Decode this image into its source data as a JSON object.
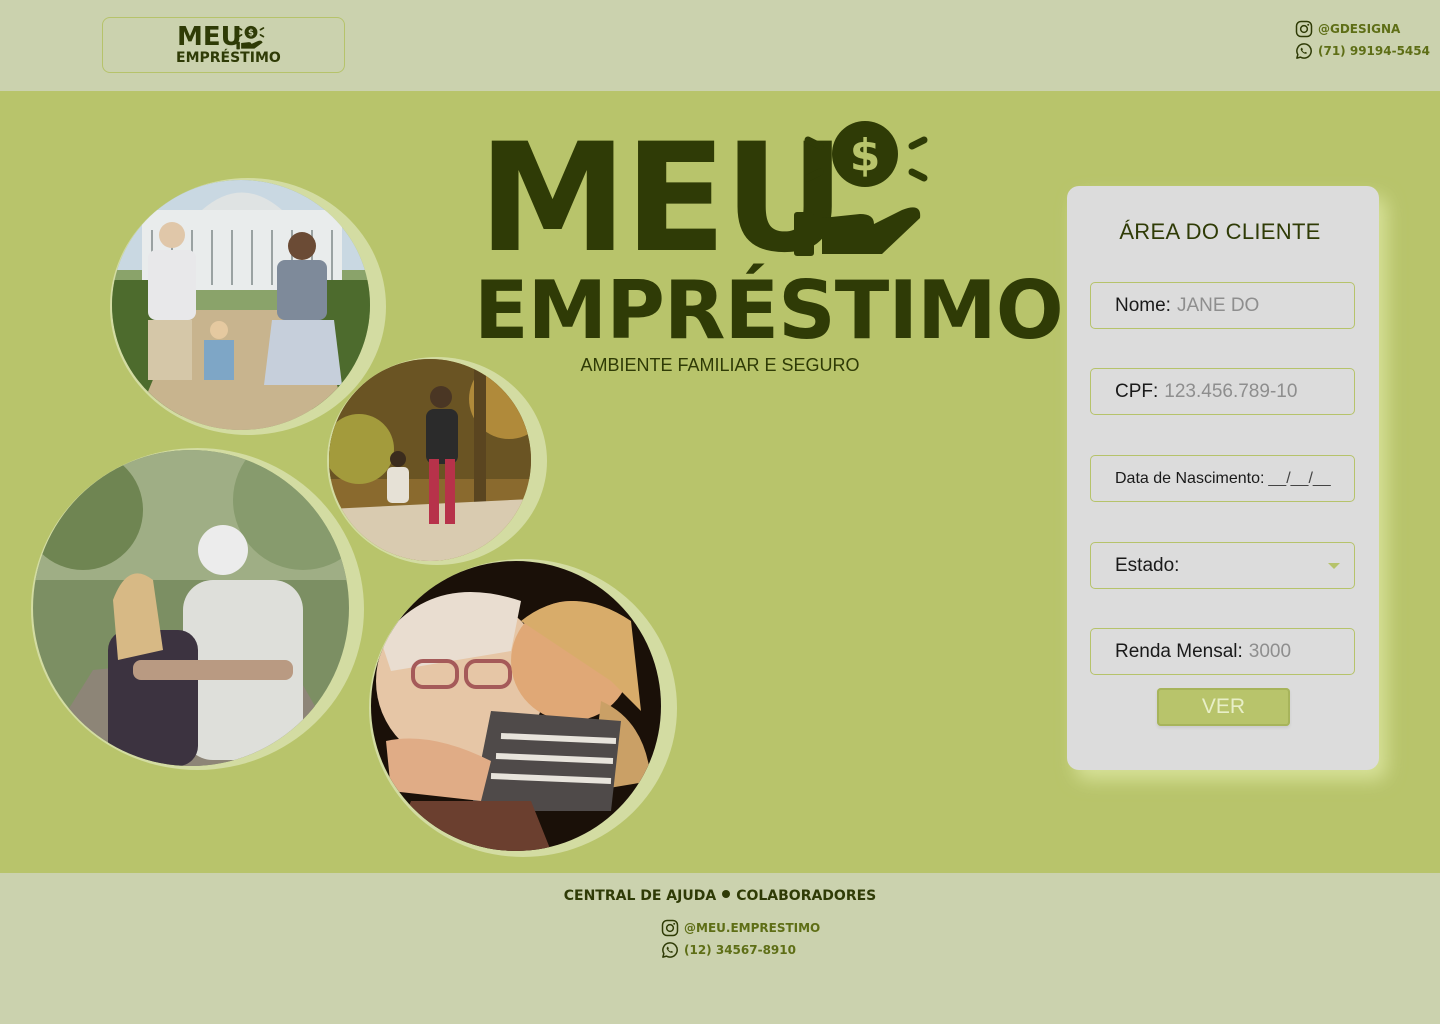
{
  "header": {
    "logo": {
      "line1": "MEU",
      "line2": "EMPRÉSTIMO"
    },
    "instagram": "@GDESIGNA",
    "whatsapp": "(71) 99194-5454"
  },
  "hero": {
    "logo_line1": "MEU",
    "logo_line2": "EMPRÉSTIMO",
    "tagline": "AMBIENTE FAMILIAR E SEGURO",
    "photos": [
      "family-walking-garden-photo",
      "grandmother-child-walking-photo",
      "grandfather-hug-granddaughter-photo",
      "grandmother-hugging-girl-photo"
    ]
  },
  "client_area": {
    "title": "ÁREA DO CLIENTE",
    "fields": {
      "nome": {
        "label": "Nome:",
        "placeholder": "JANE DO"
      },
      "cpf": {
        "label": "CPF:",
        "placeholder": "123.456.789-10"
      },
      "nascimento": {
        "label": "Data de Nascimento:",
        "placeholder": "__/__/__"
      },
      "estado": {
        "label": "Estado:",
        "value": ""
      },
      "renda": {
        "label": "Renda Mensal:",
        "placeholder": "3000"
      }
    },
    "submit_label": "VER"
  },
  "footer": {
    "link_help": "CENTRAL DE AJUDA",
    "link_collab": "COLABORADORES",
    "instagram": "@MEU.EMPRESTIMO",
    "whatsapp": "(12) 34567-8910"
  },
  "colors": {
    "header_bg": "#cbd2ae",
    "main_bg": "#b8c46b",
    "dark_green": "#2f3b06",
    "accent_green": "#5e6e16",
    "card_bg": "#dcdcdc"
  }
}
